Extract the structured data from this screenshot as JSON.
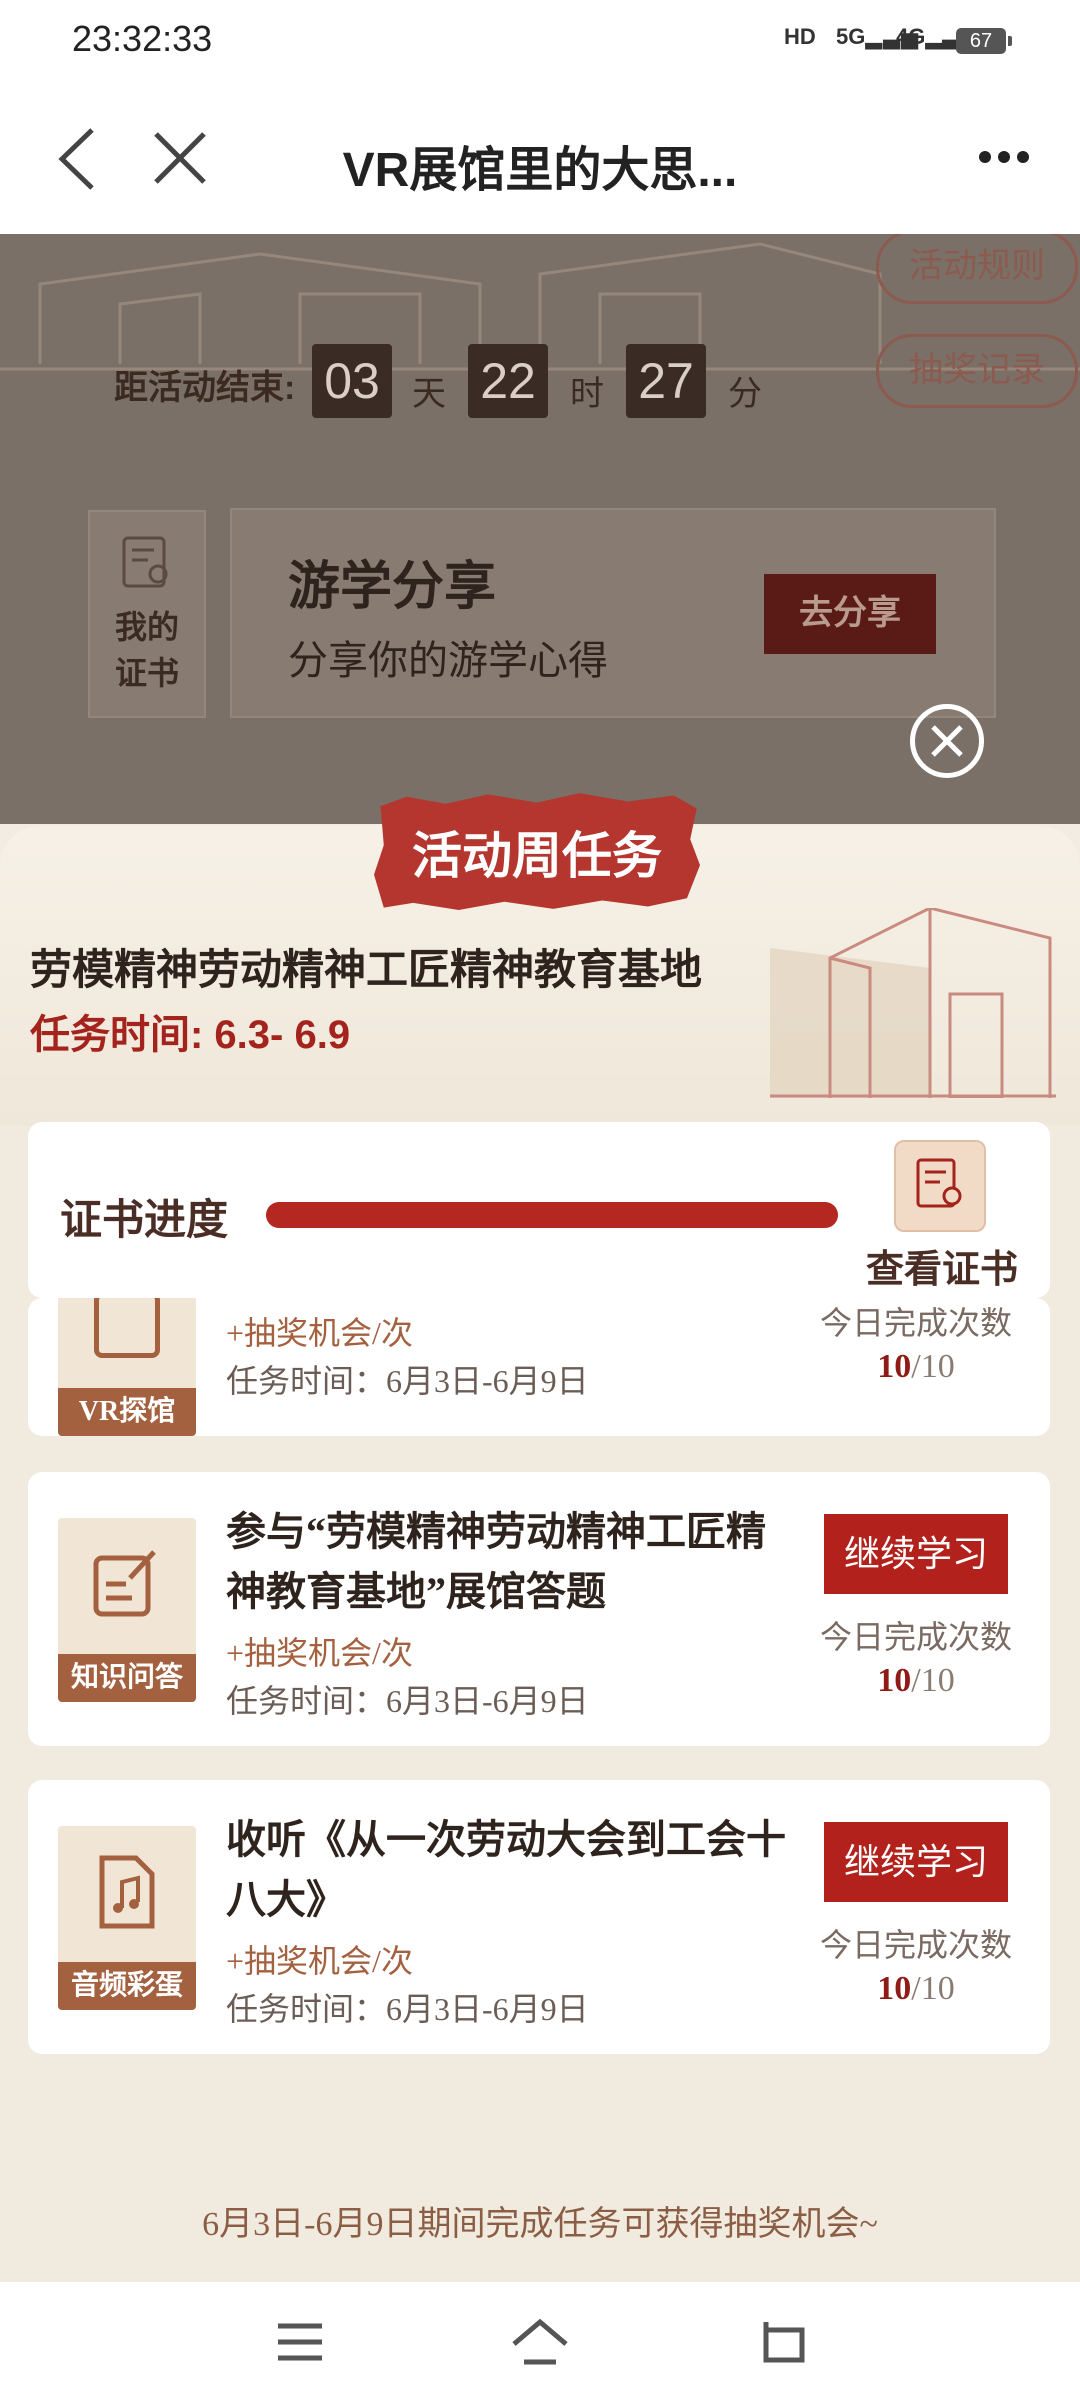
{
  "status_bar": {
    "time": "23:32:33",
    "hd_label": "HD",
    "net1": "5G",
    "net2": "4G",
    "battery": "67"
  },
  "header": {
    "title": "VR展馆里的大思..."
  },
  "background": {
    "rules_button": "活动规则",
    "lottery_record_button": "抽奖记录",
    "countdown_label": "距活动结束:",
    "days_value": "03",
    "days_unit": "天",
    "hours_value": "22",
    "hours_unit": "时",
    "minutes_value": "27",
    "minutes_unit": "分",
    "my_cert_line1": "我的",
    "my_cert_line2": "证书",
    "share_title": "游学分享",
    "share_subtitle": "分享你的游学心得",
    "share_button": "去分享"
  },
  "sheet": {
    "badge": "活动周任务",
    "site_name": "劳模精神劳动精神工匠精神教育基地",
    "task_time": "任务时间: 6.3- 6.9",
    "progress": {
      "label": "证书进度",
      "value": 1.0,
      "view_cert": "查看证书"
    },
    "tasks": [
      {
        "tag": "VR探馆",
        "title": "",
        "chance": "+抽奖机会/次",
        "time": "任务时间：6月3日-6月9日",
        "button": "",
        "count_label": "今日完成次数",
        "done": "10",
        "total": "/10"
      },
      {
        "tag": "知识问答",
        "title": "参与“劳模精神劳动精神工匠精神教育基地”展馆答题",
        "chance": "+抽奖机会/次",
        "time": "任务时间：6月3日-6月9日",
        "button": "继续学习",
        "count_label": "今日完成次数",
        "done": "10",
        "total": "/10"
      },
      {
        "tag": "音频彩蛋",
        "title": "收听《从一次劳动大会到工会十八大》",
        "chance": "+抽奖机会/次",
        "time": "任务时间：6月3日-6月9日",
        "button": "继续学习",
        "count_label": "今日完成次数",
        "done": "10",
        "total": "/10"
      }
    ],
    "footer_note": "6月3日-6月9日期间完成任务可获得抽奖机会~"
  },
  "colors": {
    "accent_red": "#b2211b",
    "brown": "#a46140",
    "sheet_bg": "#f1ebdf"
  }
}
